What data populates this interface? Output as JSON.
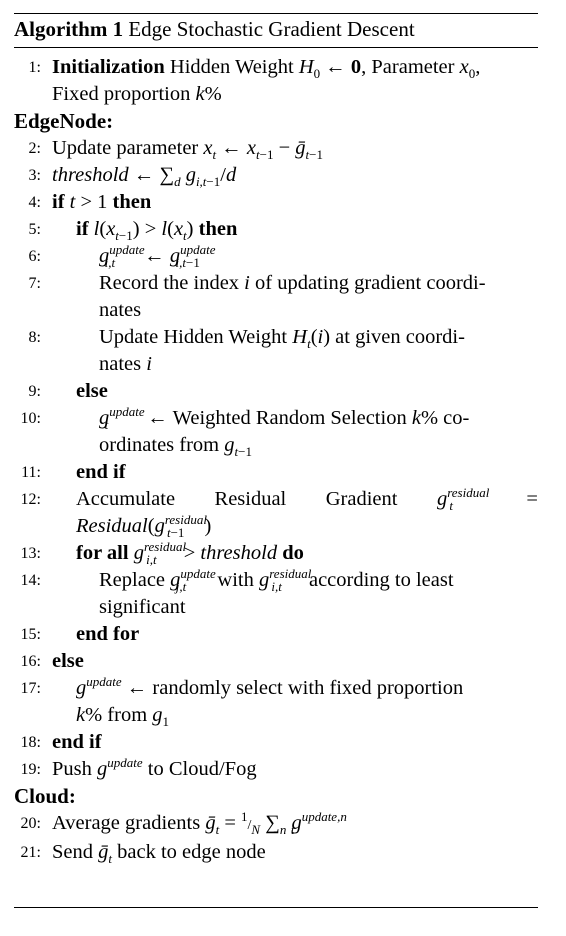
{
  "algorithm": {
    "label": "Algorithm 1",
    "title": "Edge Stochastic Gradient Descent"
  },
  "sections": {
    "edge": "EdgeNode:",
    "cloud": "Cloud:"
  },
  "lines": [
    {
      "num": "1:",
      "text": "Initialization Hidden Weight H0 ← 0, Parameter x0, Fixed proportion k%"
    },
    {
      "num": "2:",
      "text": "Update parameter xt ← xt−1 − ḡt−1"
    },
    {
      "num": "3:",
      "text": "threshold ← ∑d gi,t−1/d"
    },
    {
      "num": "4:",
      "text": "if t > 1 then"
    },
    {
      "num": "5:",
      "text": "if l(xt−1) > l(xt) then"
    },
    {
      "num": "6:",
      "text": "g_i,t^update ← g_i,t−1^update"
    },
    {
      "num": "7:",
      "text": "Record the index i of updating gradient coordinates"
    },
    {
      "num": "8:",
      "text": "Update Hidden Weight Ht(i) at given coordinates i"
    },
    {
      "num": "9:",
      "text": "else"
    },
    {
      "num": "10:",
      "text": "g_t^update ← Weighted Random Selection k% coordinates from gt−1"
    },
    {
      "num": "11:",
      "text": "end if"
    },
    {
      "num": "12:",
      "text": "Accumulate Residual Gradient g_t^residual = Residual(g_t−1^residual)"
    },
    {
      "num": "13:",
      "text": "for all g_i,t^residual > threshold do"
    },
    {
      "num": "14:",
      "text": "Replace g_j,t^update with g_i,t^residual according to least significant"
    },
    {
      "num": "15:",
      "text": "end for"
    },
    {
      "num": "16:",
      "text": "else"
    },
    {
      "num": "17:",
      "text": "g^update ← randomly select with fixed proportion k% from g1"
    },
    {
      "num": "18:",
      "text": "end if"
    },
    {
      "num": "19:",
      "text": "Push g^update to Cloud/Fog"
    },
    {
      "num": "20:",
      "text": "Average gradients ḡt = 1/N ∑n g_t^update,n"
    },
    {
      "num": "21:",
      "text": "Send ḡt back to edge node"
    }
  ]
}
